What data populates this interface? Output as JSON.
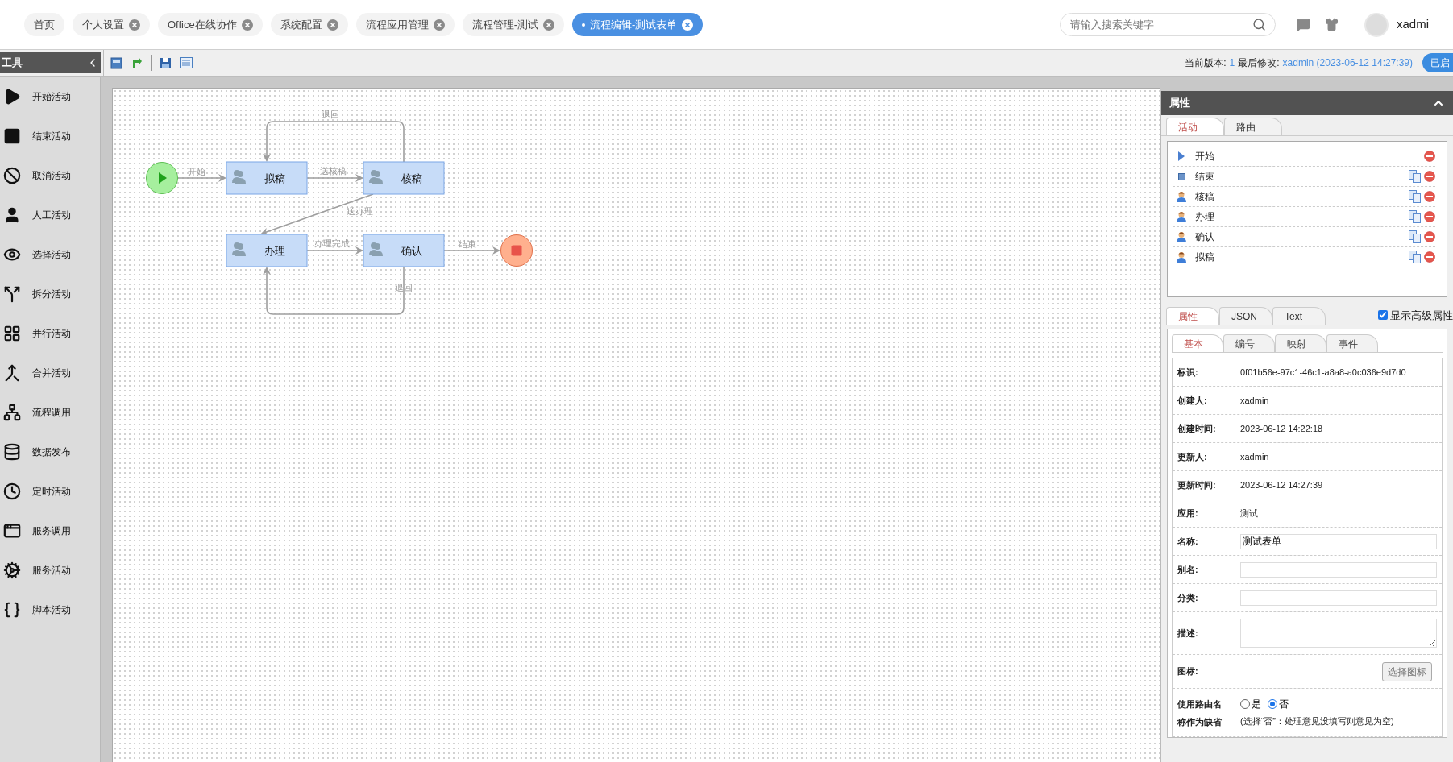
{
  "tabs": [
    {
      "label": "首页",
      "closable": false,
      "selected": false
    },
    {
      "label": "个人设置",
      "closable": true,
      "selected": false
    },
    {
      "label": "Office在线协作",
      "closable": true,
      "selected": false
    },
    {
      "label": "系统配置",
      "closable": true,
      "selected": false
    },
    {
      "label": "流程应用管理",
      "closable": true,
      "selected": false
    },
    {
      "label": "流程管理-测试",
      "closable": true,
      "selected": false
    },
    {
      "label": "流程编辑-测试表单",
      "closable": true,
      "selected": true
    }
  ],
  "search": {
    "placeholder": "请输入搜索关键字"
  },
  "user": {
    "name": "xadmi"
  },
  "toolbox": {
    "title": "工具",
    "items": [
      {
        "kind": "start",
        "label": "开始活动"
      },
      {
        "kind": "end",
        "label": "结束活动"
      },
      {
        "kind": "cancel",
        "label": "取消活动"
      },
      {
        "kind": "manual",
        "label": "人工活动"
      },
      {
        "kind": "choice",
        "label": "选择活动"
      },
      {
        "kind": "split",
        "label": "拆分活动"
      },
      {
        "kind": "parallel",
        "label": "并行活动"
      },
      {
        "kind": "merge",
        "label": "合并活动"
      },
      {
        "kind": "invoke",
        "label": "流程调用"
      },
      {
        "kind": "publish",
        "label": "数据发布"
      },
      {
        "kind": "timer",
        "label": "定时活动"
      },
      {
        "kind": "service",
        "label": "服务调用"
      },
      {
        "kind": "agent",
        "label": "服务活动"
      },
      {
        "kind": "script",
        "label": "脚本活动"
      }
    ]
  },
  "version_bar": {
    "version_label": "当前版本:",
    "version": "1",
    "modified_label": "最后修改:",
    "modified": "xadmin (2023-06-12 14:27:39)",
    "status_button": "已启"
  },
  "diagram": {
    "nodes": [
      {
        "kind": "start"
      },
      {
        "kind": "task",
        "label": "拟稿"
      },
      {
        "kind": "task",
        "label": "核稿"
      },
      {
        "kind": "task",
        "label": "办理"
      },
      {
        "kind": "task",
        "label": "确认"
      },
      {
        "kind": "end"
      }
    ],
    "edges": [
      {
        "label": "退回"
      },
      {
        "label": "开始"
      },
      {
        "label": "送核稿"
      },
      {
        "label": "送办理"
      },
      {
        "label": "办理完成"
      },
      {
        "label": "结束"
      },
      {
        "label": "退回"
      }
    ]
  },
  "properties": {
    "title": "属性",
    "list_tabs": [
      {
        "label": "活动",
        "selected": true
      },
      {
        "label": "路由",
        "selected": false
      }
    ],
    "activities": [
      {
        "kind": "start",
        "label": "开始",
        "copyable": false
      },
      {
        "kind": "end",
        "label": "结束",
        "copyable": true
      },
      {
        "kind": "task",
        "label": "核稿",
        "copyable": true
      },
      {
        "kind": "task",
        "label": "办理",
        "copyable": true
      },
      {
        "kind": "task",
        "label": "确认",
        "copyable": true
      },
      {
        "kind": "task",
        "label": "拟稿",
        "copyable": true
      }
    ],
    "tabs": [
      {
        "label": "属性",
        "selected": true
      },
      {
        "label": "JSON",
        "selected": false
      },
      {
        "label": "Text",
        "selected": false
      }
    ],
    "advanced": {
      "label": "显示高级属性",
      "checked": true
    },
    "sub_tabs": [
      {
        "label": "基本",
        "selected": true
      },
      {
        "label": "编号",
        "selected": false
      },
      {
        "label": "映射",
        "selected": false
      },
      {
        "label": "事件",
        "selected": false
      }
    ],
    "fields": [
      {
        "kind": "text",
        "label": "标识:",
        "value": "0f01b56e-97c1-46c1-a8a8-a0c036e9d7d0"
      },
      {
        "kind": "text",
        "label": "创建人:",
        "value": "xadmin"
      },
      {
        "kind": "text",
        "label": "创建时间:",
        "value": "2023-06-12 14:22:18"
      },
      {
        "kind": "text",
        "label": "更新人:",
        "value": "xadmin"
      },
      {
        "kind": "text",
        "label": "更新时间:",
        "value": "2023-06-12 14:27:39"
      },
      {
        "kind": "text",
        "label": "应用:",
        "value": "测试"
      },
      {
        "kind": "input",
        "label": "名称:",
        "value": "测试表单"
      },
      {
        "kind": "input",
        "label": "别名:"
      },
      {
        "kind": "input",
        "label": "分类:"
      },
      {
        "kind": "textarea",
        "label": "描述:"
      },
      {
        "kind": "button",
        "label": "图标:",
        "button": "选择图标"
      },
      {
        "kind": "radio",
        "label": "使用路由名称作为缺省",
        "options": [
          {
            "label": "是",
            "selected": false
          },
          {
            "label": "否",
            "selected": true
          }
        ],
        "note": "(选择“否”：处理意见没填写则意见为空)"
      }
    ]
  }
}
